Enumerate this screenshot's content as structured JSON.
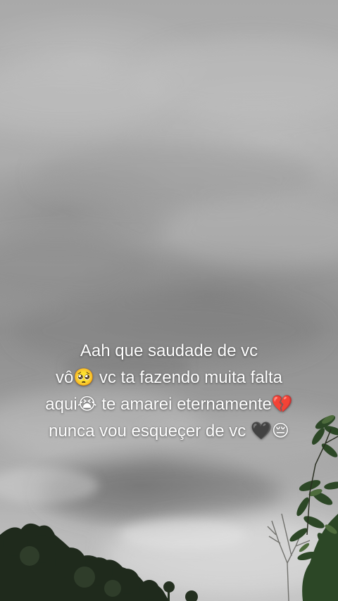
{
  "photo": {
    "subject": "overcast cloudy sky with trees at the bottom edges"
  },
  "caption": {
    "lines": [
      "Aah que saudade de vc",
      "vô🥺 vc ta fazendo muita falta",
      "aqui😭 te amarei eternamente💔",
      "nunca vou esqueçer de vc 🖤😔"
    ]
  }
}
